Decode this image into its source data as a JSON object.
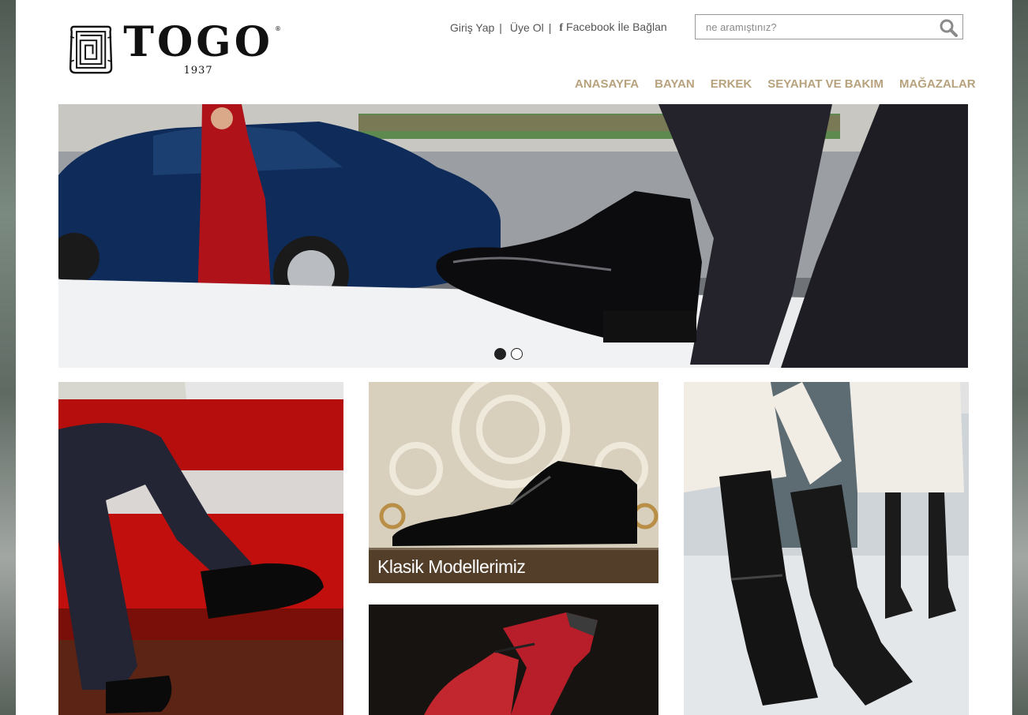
{
  "brand": {
    "name": "TOGO",
    "registered_mark": "®",
    "year": "1937"
  },
  "top_links": {
    "login": "Giriş Yap",
    "signup": "Üye Ol",
    "separator": "|",
    "facebook_icon_glyph": "f",
    "facebook": "Facebook İle Bağlan"
  },
  "search": {
    "placeholder": "ne aramıştınız?",
    "icon": "search-icon"
  },
  "nav": {
    "items": [
      {
        "label": "ANASAYFA"
      },
      {
        "label": "BAYAN"
      },
      {
        "label": "ERKEK"
      },
      {
        "label": "SEYAHAT VE BAKIM"
      },
      {
        "label": "MAĞAZALAR"
      }
    ]
  },
  "hero": {
    "slides_total": 2,
    "active_slide": 1
  },
  "tiles": {
    "mid_top_caption": "Klasik Modellerimiz"
  },
  "colors": {
    "nav_gold": "#b7a27d",
    "text_gray": "#555555",
    "caption_overlay": "#46321e"
  }
}
